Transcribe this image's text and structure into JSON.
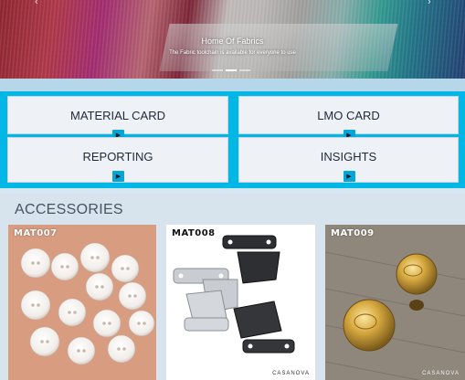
{
  "hero": {
    "title": "Home Of Fabrics",
    "subtitle": "The Fabric toolchain is available for everyone to use",
    "prev_icon": "chevron-left-icon",
    "next_icon": "chevron-right-icon"
  },
  "menu": {
    "tiles": [
      {
        "label": "MATERIAL CARD",
        "icon": "chevron-right-icon"
      },
      {
        "label": "LMO CARD",
        "icon": "chevron-right-icon"
      },
      {
        "label": "REPORTING",
        "icon": "chevron-right-icon"
      },
      {
        "label": "INSIGHTS",
        "icon": "chevron-right-icon"
      }
    ]
  },
  "accessories": {
    "title": "ACCESSORIES",
    "products": [
      {
        "code": "MAT007",
        "image": "white-buttons"
      },
      {
        "code": "MAT008",
        "image": "hook-and-eye-fasteners",
        "brand": "CASANOVA"
      },
      {
        "code": "MAT009",
        "image": "gold-shank-buttons",
        "brand": "CASANOVA"
      }
    ]
  },
  "colors": {
    "accent": "#00b7e6",
    "tile_bg": "#eef2f6",
    "section_bg": "#d7e4ee"
  }
}
